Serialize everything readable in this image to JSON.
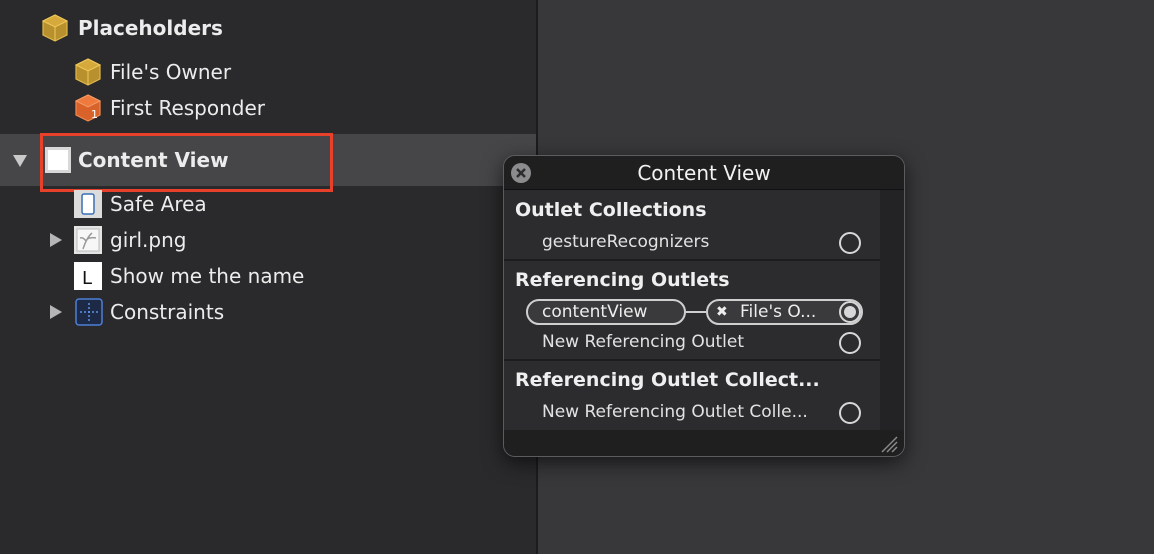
{
  "outline": {
    "items": [
      {
        "label": "Placeholders",
        "bold": true,
        "icon": "placeholder-cube-icon"
      },
      {
        "label": "File's Owner",
        "bold": false,
        "icon": "placeholder-cube-icon"
      },
      {
        "label": "First Responder",
        "bold": false,
        "icon": "first-responder-icon"
      },
      {
        "label": "Content View",
        "bold": true,
        "icon": "view-icon",
        "expanded": true,
        "selected": true
      },
      {
        "label": "Safe Area",
        "bold": false,
        "icon": "safe-area-icon"
      },
      {
        "label": "girl.png",
        "bold": false,
        "icon": "image-view-icon",
        "collapsed": true
      },
      {
        "label": "Show me the name",
        "bold": false,
        "icon": "label-icon"
      },
      {
        "label": "Constraints",
        "bold": false,
        "icon": "constraints-icon",
        "collapsed": true
      }
    ],
    "highlight_color": "#e8412b"
  },
  "popover": {
    "title": "Content View",
    "sections": {
      "outlet_collections": {
        "title": "Outlet Collections",
        "items": [
          "gestureRecognizers"
        ]
      },
      "referencing_outlets": {
        "title": "Referencing Outlets",
        "connection": {
          "outlet": "contentView",
          "target": "File's O..."
        },
        "new_item": "New Referencing Outlet"
      },
      "referencing_outlet_collections": {
        "title": "Referencing Outlet Collect...",
        "new_item": "New Referencing Outlet Colle..."
      }
    },
    "remove_glyph": "✖"
  }
}
